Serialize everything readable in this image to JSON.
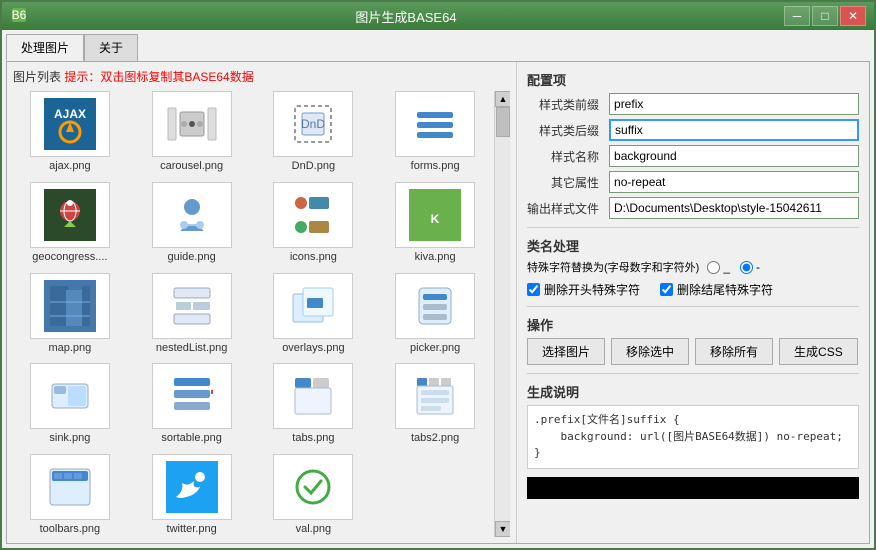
{
  "window": {
    "title": "图片生成BASE64",
    "icon": "⚡"
  },
  "title_controls": {
    "minimize": "─",
    "maximize": "□",
    "close": "✕"
  },
  "tabs": [
    {
      "label": "处理图片",
      "active": true
    },
    {
      "label": "关于",
      "active": false
    }
  ],
  "left_panel": {
    "hint_label": "图片列表",
    "hint_text": "提示：双击图标复制其BASE64数据",
    "images": [
      {
        "name": "ajax.png",
        "icon": "ajax"
      },
      {
        "name": "carousel.png",
        "icon": "carousel"
      },
      {
        "name": "DnD.png",
        "icon": "dnd"
      },
      {
        "name": "forms.png",
        "icon": "forms"
      },
      {
        "name": "geocongress....",
        "icon": "geo"
      },
      {
        "name": "guide.png",
        "icon": "guide"
      },
      {
        "name": "icons.png",
        "icon": "icons"
      },
      {
        "name": "kiva.png",
        "icon": "kiva"
      },
      {
        "name": "map.png",
        "icon": "map"
      },
      {
        "name": "nestedList.png",
        "icon": "nestedlist"
      },
      {
        "name": "overlays.png",
        "icon": "overlays"
      },
      {
        "name": "picker.png",
        "icon": "picker"
      },
      {
        "name": "sink.png",
        "icon": "sink"
      },
      {
        "name": "sortable.png",
        "icon": "sortable"
      },
      {
        "name": "tabs.png",
        "icon": "tabs"
      },
      {
        "name": "tabs2.png",
        "icon": "tabs2"
      },
      {
        "name": "toolbars.png",
        "icon": "toolbars"
      },
      {
        "name": "twitter.png",
        "icon": "twitter"
      },
      {
        "name": "val.png",
        "icon": "val"
      }
    ]
  },
  "right_panel": {
    "config_section": "配置项",
    "fields": [
      {
        "label": "样式类前缀",
        "value": "prefix",
        "id": "prefix"
      },
      {
        "label": "样式类后缀",
        "value": "suffix",
        "id": "suffix",
        "highlighted": true
      },
      {
        "label": "样式名称",
        "value": "background",
        "id": "style-name"
      },
      {
        "label": "其它属性",
        "value": "no-repeat",
        "id": "other-attr"
      },
      {
        "label": "输出样式文件",
        "value": "D:\\Documents\\Desktop\\style-15042611",
        "id": "output-file"
      }
    ],
    "class_section": "类名处理",
    "special_char_label": "特殊字符替换为(字母数字和字符外)",
    "radio_options": [
      {
        "label": "_",
        "value": "_"
      },
      {
        "label": "-",
        "value": "-",
        "selected": true
      }
    ],
    "checkboxes": [
      {
        "label": "删除开头特殊字符",
        "checked": true
      },
      {
        "label": "删除结尾特殊字符",
        "checked": true
      }
    ],
    "operation_section": "操作",
    "buttons": [
      {
        "label": "选择图片"
      },
      {
        "label": "移除选中"
      },
      {
        "label": "移除所有"
      },
      {
        "label": "生成CSS"
      }
    ],
    "generate_section": "生成说明",
    "code_preview": ".prefix[文件名]suffix {\n\tbackground: url([图片BASE64数据]) no-repeat;\n}"
  }
}
